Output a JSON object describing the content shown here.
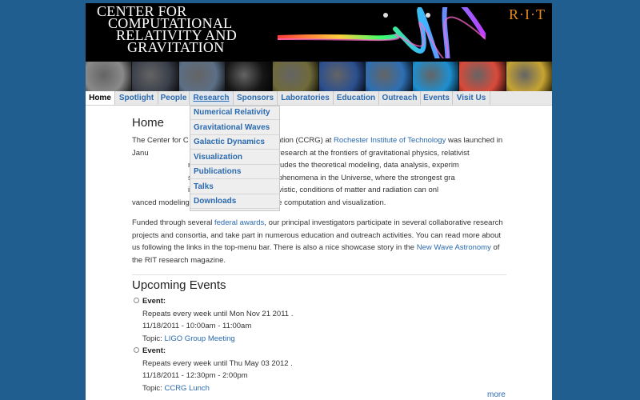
{
  "banner": {
    "title_lines": [
      "Center for",
      "Computational",
      "Relativity and",
      "Gravitation"
    ],
    "logo_text": "R·I·T"
  },
  "thumbnails": [
    {
      "icon": "einstein-portrait",
      "color": "#8a8a8a"
    },
    {
      "icon": "galaxy-image",
      "color": "#3a3f4a"
    },
    {
      "icon": "computer-cluster",
      "color": "#5c6f86"
    },
    {
      "icon": "constellation",
      "color": "#151515"
    },
    {
      "icon": "simulation-grid",
      "color": "#6f6a3a"
    },
    {
      "icon": "blackhole-visual",
      "color": "#2b4f8f"
    },
    {
      "icon": "wave-surface",
      "color": "#2d6fb4"
    },
    {
      "icon": "orbit-visual",
      "color": "#1d8fd0"
    },
    {
      "icon": "rainbow-field",
      "color": "#d94a3a"
    },
    {
      "icon": "spectrum-pattern",
      "color": "#c7a431"
    }
  ],
  "nav": {
    "items": [
      "Home",
      "Spotlight",
      "People",
      "Research",
      "Sponsors",
      "Laboratories",
      "Education",
      "Outreach",
      "Events",
      "Visit Us"
    ]
  },
  "dropdown": {
    "items": [
      "Numerical Relativity",
      "Gravitational Waves",
      "Galactic Dynamics",
      "Visualization",
      "Publications",
      "Talks",
      "Downloads"
    ]
  },
  "content": {
    "heading": "Home",
    "p1_start": "The Center for C",
    "p1_gap1": "ed Gravitation (CCRG) at ",
    "p1_link": "Rochester Institute of Technology",
    "p1_rest1": " was launched in Janu",
    "p1_rest2": "ry mission to conduct research at the frontiers of gravitational physics, relativist",
    "p1_rest3": "nced computation. This includes the theoretical modeling, data analysis, experim",
    "p1_rest4": "some of the most extreme phenomena in the Universe, where the strongest gra",
    "p1_rest5": "ields, the very dense, relativistic, conditions of matter and radiation can onl",
    "p1_rest6": "vanced modeling and simulation, large-scale computation and visualization.",
    "p2_start": "Funded through several ",
    "p2_link1": "federal awards",
    "p2_mid": ", our principal investigators participate in several collaborative research projects and consortia, and take part in numerous education and outreach activities.  You can read more about us following the links in the top-menu bar. There is also a nice showcase story in the ",
    "p2_link2": "New Wave Astronomy",
    "p2_end": " of the RIT research magazine.",
    "events_heading": "Upcoming Events",
    "events": [
      {
        "label": "Event:",
        "repeat": "Repeats every week until Mon Nov 21 2011 .",
        "time": "11/18/2011 - 10:00am - 11:00am",
        "topic_label": "Topic: ",
        "topic": "LIGO Group Meeting"
      },
      {
        "label": "Event:",
        "repeat": "Repeats every week until Thu May 03 2012 .",
        "time": "11/18/2011 - 12:30pm - 2:00pm",
        "topic_label": "Topic: ",
        "topic": "CCRG Lunch"
      }
    ],
    "more": "more"
  }
}
